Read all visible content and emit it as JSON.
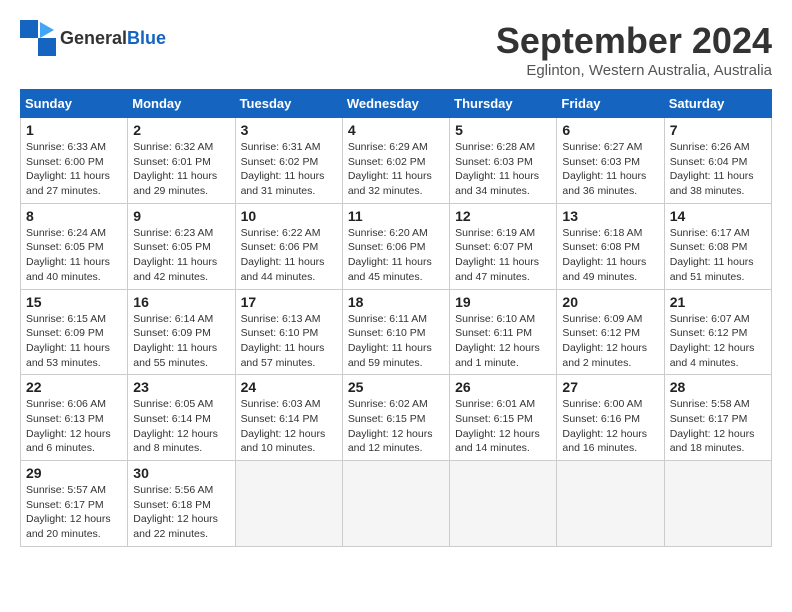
{
  "header": {
    "logo_general": "General",
    "logo_blue": "Blue",
    "month_title": "September 2024",
    "location": "Eglinton, Western Australia, Australia"
  },
  "weekdays": [
    "Sunday",
    "Monday",
    "Tuesday",
    "Wednesday",
    "Thursday",
    "Friday",
    "Saturday"
  ],
  "weeks": [
    [
      {
        "day": 1,
        "sunrise": "6:33 AM",
        "sunset": "6:00 PM",
        "daylight": "11 hours and 27 minutes"
      },
      {
        "day": 2,
        "sunrise": "6:32 AM",
        "sunset": "6:01 PM",
        "daylight": "11 hours and 29 minutes"
      },
      {
        "day": 3,
        "sunrise": "6:31 AM",
        "sunset": "6:02 PM",
        "daylight": "11 hours and 31 minutes"
      },
      {
        "day": 4,
        "sunrise": "6:29 AM",
        "sunset": "6:02 PM",
        "daylight": "11 hours and 32 minutes"
      },
      {
        "day": 5,
        "sunrise": "6:28 AM",
        "sunset": "6:03 PM",
        "daylight": "11 hours and 34 minutes"
      },
      {
        "day": 6,
        "sunrise": "6:27 AM",
        "sunset": "6:03 PM",
        "daylight": "11 hours and 36 minutes"
      },
      {
        "day": 7,
        "sunrise": "6:26 AM",
        "sunset": "6:04 PM",
        "daylight": "11 hours and 38 minutes"
      }
    ],
    [
      {
        "day": 8,
        "sunrise": "6:24 AM",
        "sunset": "6:05 PM",
        "daylight": "11 hours and 40 minutes"
      },
      {
        "day": 9,
        "sunrise": "6:23 AM",
        "sunset": "6:05 PM",
        "daylight": "11 hours and 42 minutes"
      },
      {
        "day": 10,
        "sunrise": "6:22 AM",
        "sunset": "6:06 PM",
        "daylight": "11 hours and 44 minutes"
      },
      {
        "day": 11,
        "sunrise": "6:20 AM",
        "sunset": "6:06 PM",
        "daylight": "11 hours and 45 minutes"
      },
      {
        "day": 12,
        "sunrise": "6:19 AM",
        "sunset": "6:07 PM",
        "daylight": "11 hours and 47 minutes"
      },
      {
        "day": 13,
        "sunrise": "6:18 AM",
        "sunset": "6:08 PM",
        "daylight": "11 hours and 49 minutes"
      },
      {
        "day": 14,
        "sunrise": "6:17 AM",
        "sunset": "6:08 PM",
        "daylight": "11 hours and 51 minutes"
      }
    ],
    [
      {
        "day": 15,
        "sunrise": "6:15 AM",
        "sunset": "6:09 PM",
        "daylight": "11 hours and 53 minutes"
      },
      {
        "day": 16,
        "sunrise": "6:14 AM",
        "sunset": "6:09 PM",
        "daylight": "11 hours and 55 minutes"
      },
      {
        "day": 17,
        "sunrise": "6:13 AM",
        "sunset": "6:10 PM",
        "daylight": "11 hours and 57 minutes"
      },
      {
        "day": 18,
        "sunrise": "6:11 AM",
        "sunset": "6:10 PM",
        "daylight": "11 hours and 59 minutes"
      },
      {
        "day": 19,
        "sunrise": "6:10 AM",
        "sunset": "6:11 PM",
        "daylight": "12 hours and 1 minute"
      },
      {
        "day": 20,
        "sunrise": "6:09 AM",
        "sunset": "6:12 PM",
        "daylight": "12 hours and 2 minutes"
      },
      {
        "day": 21,
        "sunrise": "6:07 AM",
        "sunset": "6:12 PM",
        "daylight": "12 hours and 4 minutes"
      }
    ],
    [
      {
        "day": 22,
        "sunrise": "6:06 AM",
        "sunset": "6:13 PM",
        "daylight": "12 hours and 6 minutes"
      },
      {
        "day": 23,
        "sunrise": "6:05 AM",
        "sunset": "6:14 PM",
        "daylight": "12 hours and 8 minutes"
      },
      {
        "day": 24,
        "sunrise": "6:03 AM",
        "sunset": "6:14 PM",
        "daylight": "12 hours and 10 minutes"
      },
      {
        "day": 25,
        "sunrise": "6:02 AM",
        "sunset": "6:15 PM",
        "daylight": "12 hours and 12 minutes"
      },
      {
        "day": 26,
        "sunrise": "6:01 AM",
        "sunset": "6:15 PM",
        "daylight": "12 hours and 14 minutes"
      },
      {
        "day": 27,
        "sunrise": "6:00 AM",
        "sunset": "6:16 PM",
        "daylight": "12 hours and 16 minutes"
      },
      {
        "day": 28,
        "sunrise": "5:58 AM",
        "sunset": "6:17 PM",
        "daylight": "12 hours and 18 minutes"
      }
    ],
    [
      {
        "day": 29,
        "sunrise": "5:57 AM",
        "sunset": "6:17 PM",
        "daylight": "12 hours and 20 minutes"
      },
      {
        "day": 30,
        "sunrise": "5:56 AM",
        "sunset": "6:18 PM",
        "daylight": "12 hours and 22 minutes"
      },
      null,
      null,
      null,
      null,
      null
    ]
  ]
}
